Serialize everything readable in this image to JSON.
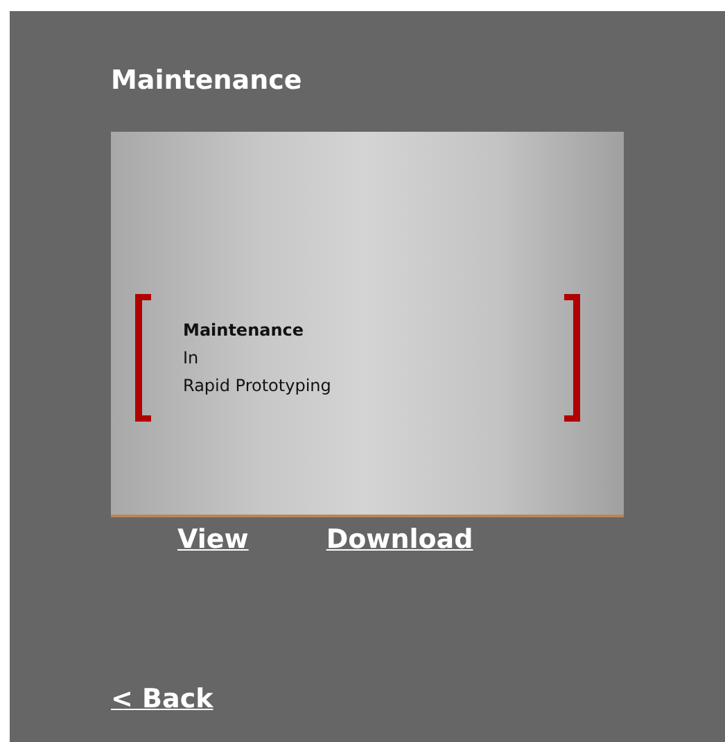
{
  "title": "Maintenance",
  "slide": {
    "lines": [
      "Maintenance",
      "In",
      "Rapid Prototyping"
    ]
  },
  "links": [
    "View",
    "Download"
  ],
  "back": "< Back"
}
